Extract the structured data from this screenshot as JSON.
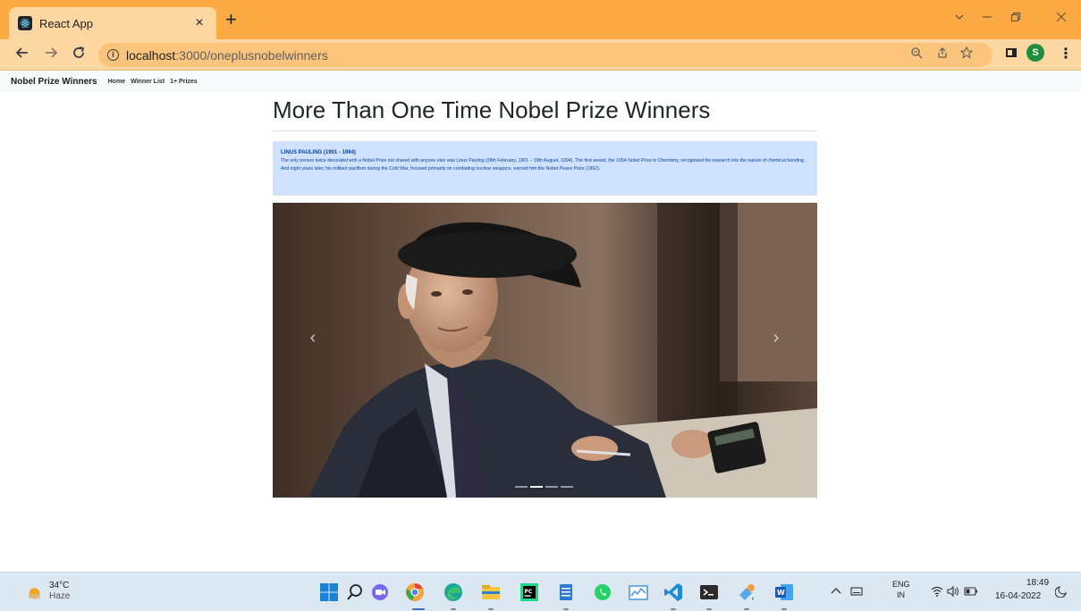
{
  "browser": {
    "tab_title": "React App",
    "tab_close": "×",
    "new_tab": "+",
    "url_host": "localhost",
    "url_path": ":3000/oneplusnobelwinners",
    "avatar_letter": "S"
  },
  "navbar": {
    "brand": "Nobel Prize Winners",
    "links": [
      "Home",
      "Winner List",
      "1+ Prizes"
    ]
  },
  "page": {
    "title": "More Than One Time Nobel Prize Winners",
    "alert": {
      "heading": "LINUS PAULING (1901 - 1994)",
      "body": "The only person twice decorated with a Nobel Prize not shared with anyone else was Linus Pauling (28th February, 1901 – 19th August, 1994). The first award, the 1954 Nobel Prize in Chemistry, recognized his research into the nature of chemical bonding. And eight years later, his militant pacifism during the Cold War, focused primarily on combating nuclear weapons, earned him the Nobel Peace Prize (1962)."
    },
    "carousel": {
      "prev": "‹",
      "next": "›",
      "slide_count": 4,
      "active_slide": 2
    }
  },
  "taskbar": {
    "weather_temp": "34°C",
    "weather_cond": "Haze",
    "lang_top": "ENG",
    "lang_bottom": "IN",
    "time": "18:49",
    "date": "16-04-2022"
  }
}
